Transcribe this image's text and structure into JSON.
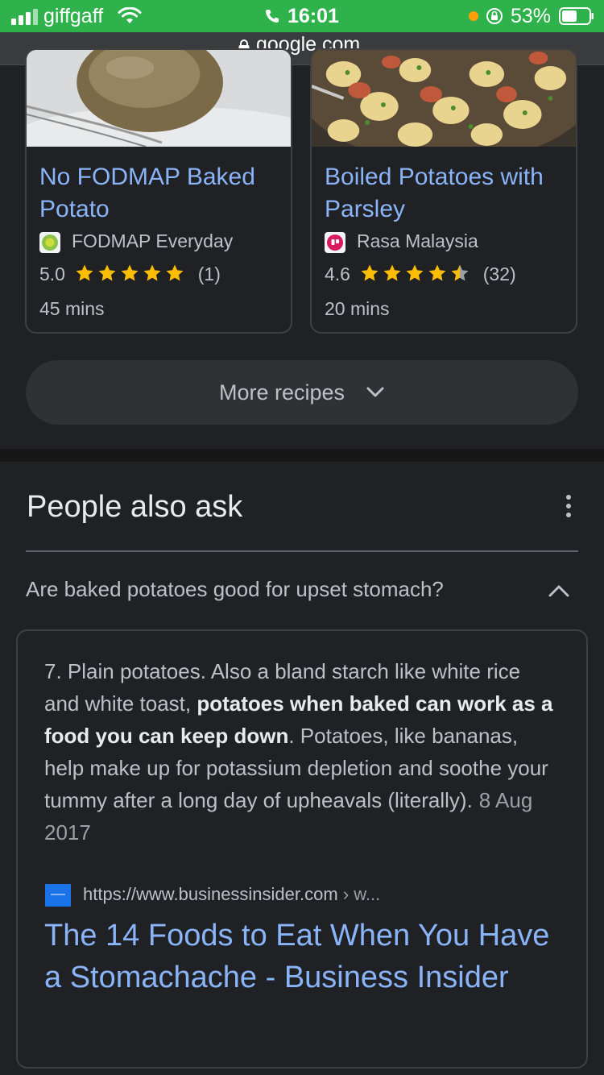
{
  "status_bar": {
    "carrier": "giffgaff",
    "time": "16:01",
    "battery": "53%"
  },
  "browser": {
    "url": "google.com"
  },
  "recipes": [
    {
      "title": "No FODMAP Baked Potato",
      "source": "FODMAP Everyday",
      "rating": "5.0",
      "stars": 5,
      "reviews": "(1)",
      "time": "45 mins",
      "source_icon_color": "#8bc34a"
    },
    {
      "title": "Boiled Potatoes with Parsley",
      "source": "Rasa Malaysia",
      "rating": "4.6",
      "stars": 4.5,
      "reviews": "(32)",
      "time": "20 mins",
      "source_icon_color": "#d81b60"
    }
  ],
  "more_recipes": {
    "label": "More recipes"
  },
  "people_also_ask": {
    "heading": "People also ask",
    "question": "Are baked potatoes good for upset stomach?",
    "answer": {
      "text_before": "7. Plain potatoes. Also a bland starch like white rice and white toast, ",
      "text_bold": "potatoes when baked can work as a food you can keep down",
      "text_after": ". Potatoes, like bananas, help make up for potassium depletion and soothe your tummy after a long day of upheavals (literally).",
      "date": "8 Aug 2017"
    },
    "result": {
      "url": "https://www.businessinsider.com",
      "breadcrumb": "› w...",
      "title": "The 14 Foods to Eat When You Have a Stomachache - Business Insider"
    }
  },
  "colors": {
    "link": "#8ab4f8",
    "star": "#fbbc04",
    "status_bar_bg": "#2fb24c"
  }
}
